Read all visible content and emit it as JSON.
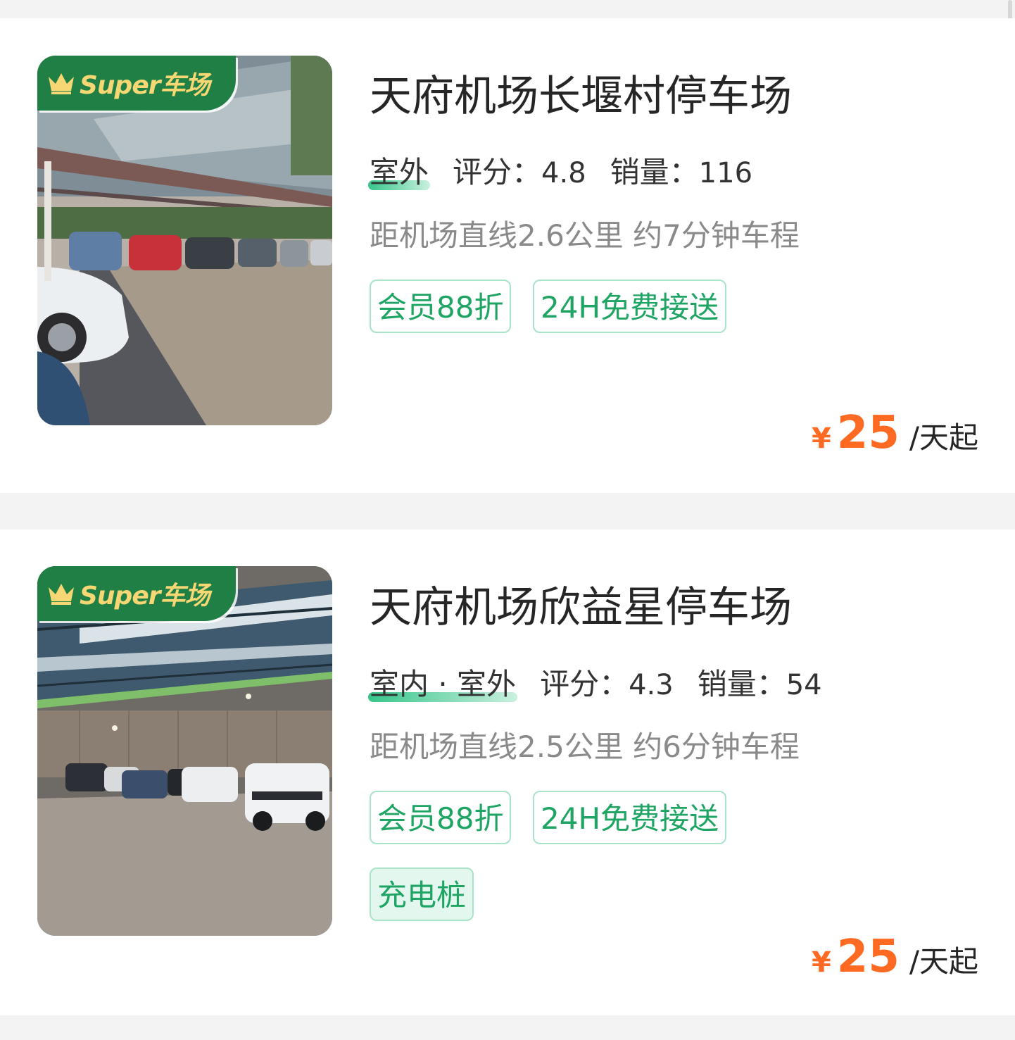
{
  "listings": [
    {
      "badge": "Super车场",
      "name": "天府机场长堰村停车场",
      "environment": "室外",
      "rating_label": "评分：",
      "rating": "4.8",
      "sales_label": "销量：",
      "sales": "116",
      "distance": "距机场直线2.6公里 约7分钟车程",
      "tags": [
        "会员88折",
        "24H免费接送"
      ],
      "currency": "¥",
      "price": "25",
      "price_unit": "/天起"
    },
    {
      "badge": "Super车场",
      "name": "天府机场欣益星停车场",
      "environment": "室内 · 室外",
      "rating_label": "评分：",
      "rating": "4.3",
      "sales_label": "销量：",
      "sales": "54",
      "distance": "距机场直线2.5公里 约6分钟车程",
      "tags": [
        "会员88折",
        "24H免费接送",
        "充电桩"
      ],
      "currency": "¥",
      "price": "25",
      "price_unit": "/天起"
    }
  ],
  "colors": {
    "accent_green": "#1ea463",
    "badge_green": "#1f7f45",
    "price_orange": "#ff6a22"
  }
}
